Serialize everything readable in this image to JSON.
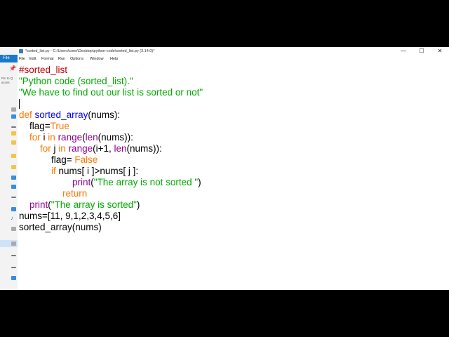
{
  "explorer": {
    "file_tab": "File",
    "pin_text_1": "Pin to Q",
    "pin_text_2": "acces"
  },
  "window": {
    "title": "*sorted_list.py - C:\\Users\\conn\\Desktop\\python-code\\sorted_list.py (3.14.0)*",
    "controls": {
      "minimize": "—",
      "maximize": "☐",
      "close": "✕"
    }
  },
  "menu": [
    "File",
    "Edit",
    "Format",
    "Run",
    "Options",
    "Window",
    "Help"
  ],
  "code": {
    "l1_comment": "#sorted_list",
    "l2_string": "\"Python code (sorted_list).\"",
    "l3_string": "\"We have to find out our list is sorted or not\"",
    "l5_kw": "def",
    "l5_name": "sorted_array",
    "l5_rest": "(nums):",
    "l6_a": "flag=",
    "l6_kw": "True",
    "l7_kw1": "for",
    "l7_a": " i ",
    "l7_kw2": "in",
    "l7_sp": " ",
    "l7_b1": "range",
    "l7_p": "(",
    "l7_b2": "len",
    "l7_rest": "(nums)):",
    "l8_kw1": "for",
    "l8_a": " j ",
    "l8_kw2": "in",
    "l8_sp": " ",
    "l8_b1": "range",
    "l8_mid": "(i+1, ",
    "l8_b2": "len",
    "l8_rest": "(nums)):",
    "l9_a": "flag= ",
    "l9_kw": "False",
    "l10_kw": "if",
    "l10_rest": " nums[ i ]>nums[ j ]:",
    "l11_b": "print",
    "l11_p": "(",
    "l11_s": "\"The array is not sorted \"",
    "l11_e": ")",
    "l12_kw": "return",
    "l13_b": "print",
    "l13_p": "(",
    "l13_s": "\"The array is sorted\"",
    "l13_e": ")",
    "l14": "nums=[11, 9,1,2,3,4,5,6]",
    "l15": "sorted_array(nums)"
  }
}
